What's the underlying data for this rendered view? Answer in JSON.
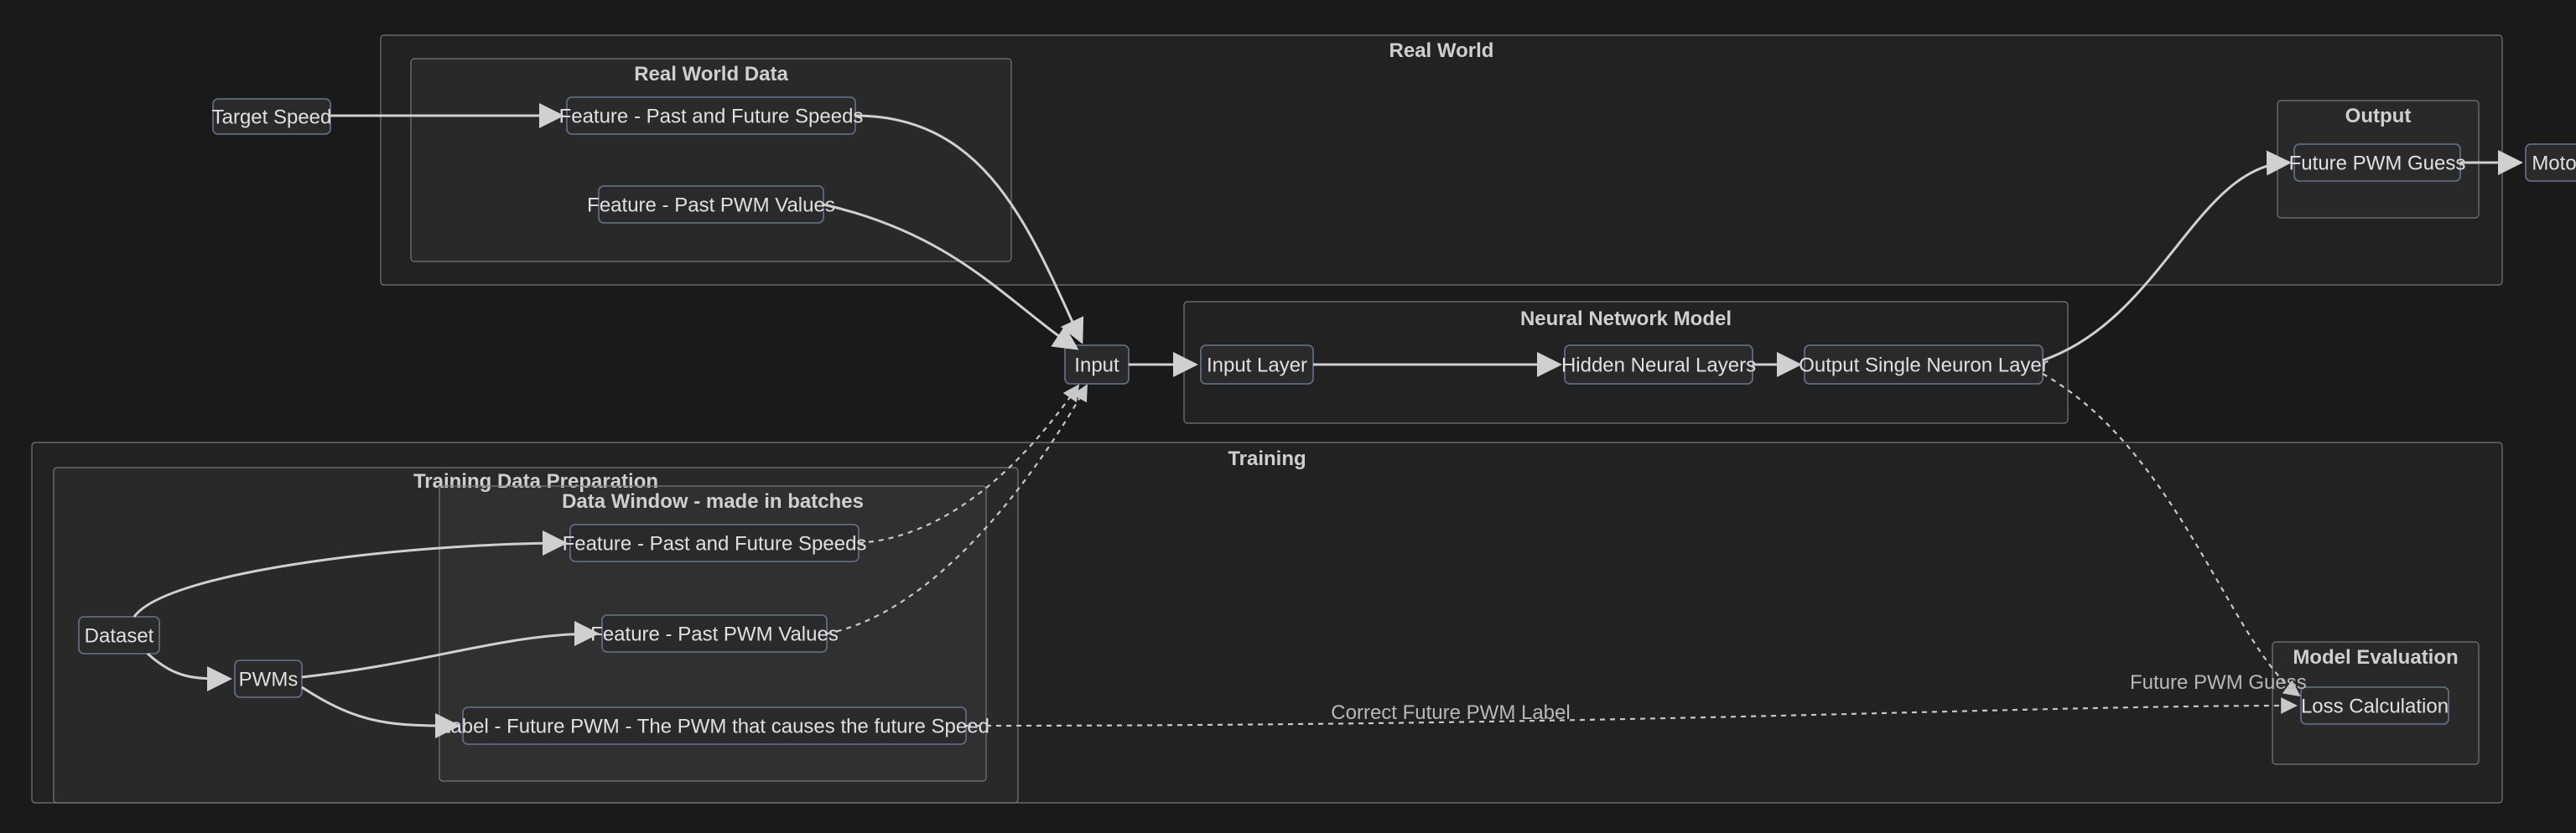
{
  "groups": {
    "real_world": "Real World",
    "real_world_data": "Real World Data",
    "output": "Output",
    "neural_network": "Neural Network Model",
    "training": "Training",
    "training_data_prep": "Training Data Preparation",
    "data_window": "Data Window - made in batches",
    "model_eval": "Model Evaluation"
  },
  "nodes": {
    "target_speed": "Target Speed",
    "feat_speeds_rw": "Feature - Past and Future Speeds",
    "feat_pwm_rw": "Feature - Past PWM Values",
    "future_pwm_guess": "Future PWM Guess",
    "motor": "Motor",
    "input": "Input",
    "input_layer": "Input Layer",
    "hidden_layers": "Hidden Neural Layers",
    "output_layer": "Output Single Neuron Layer",
    "dataset": "Dataset",
    "pwms": "PWMs",
    "feat_speeds_tr": "Feature - Past and Future Speeds",
    "feat_pwm_tr": "Feature - Past PWM Values",
    "label_future_pwm": "Label - Future PWM - The PWM that causes the future Speed",
    "loss_calc": "Loss Calculation"
  },
  "edge_labels": {
    "correct_future_pwm": "Correct Future PWM Label",
    "future_pwm_guess": "Future PWM Guess"
  }
}
